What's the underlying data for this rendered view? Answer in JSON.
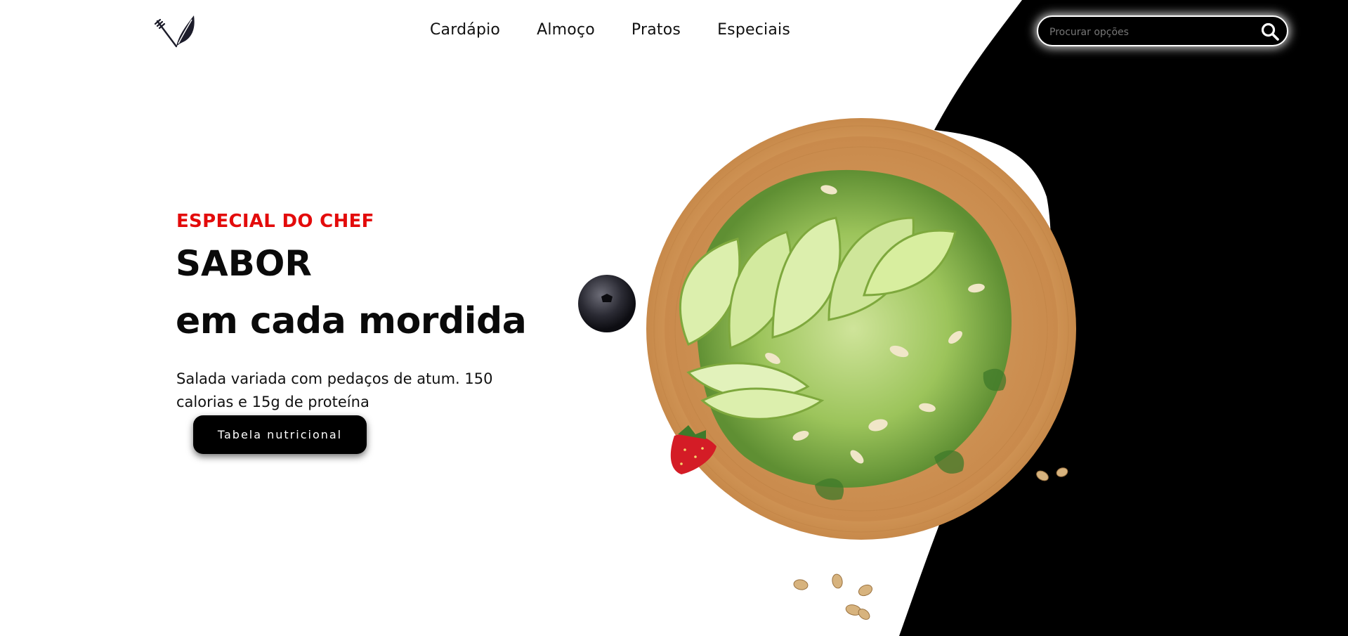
{
  "nav": {
    "items": [
      "Cardápio",
      "Almoço",
      "Pratos",
      "Especiais"
    ]
  },
  "search": {
    "placeholder": "Procurar opções",
    "icon": "search-icon"
  },
  "hero": {
    "eyebrow": "ESPECIAL DO CHEF",
    "title_line1": "SABOR",
    "title_line2": "em cada mordida",
    "description": "Salada variada com pedaços de atum. 150 calorias e 15g de proteína",
    "cta_label": "Tabela nutricional"
  },
  "colors": {
    "accent": "#e30b0b",
    "dark": "#000000",
    "background": "#ffffff"
  },
  "icons": [
    "fork-leaf-logo-icon",
    "search-icon"
  ]
}
